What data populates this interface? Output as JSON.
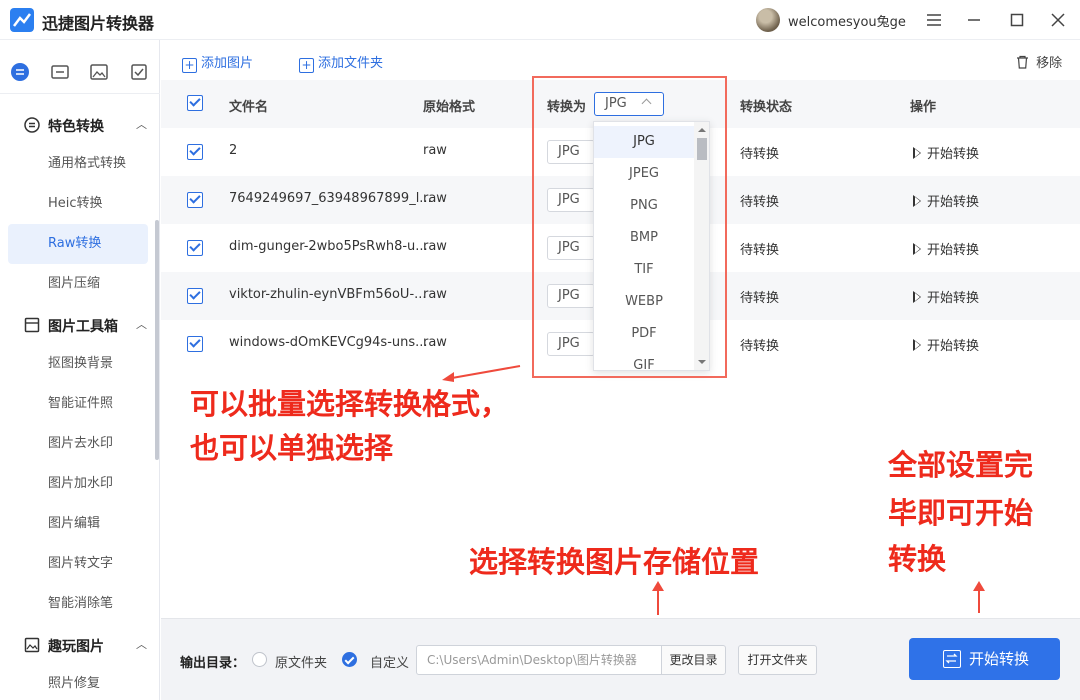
{
  "app": {
    "title": "迅捷图片转换器",
    "username": "welcomesyou兔ge",
    "window_controls": [
      "menu-icon",
      "minimize-icon",
      "maximize-icon",
      "close-icon"
    ]
  },
  "sidebar": {
    "top_icons": [
      "convert-icon",
      "toolbox-icon",
      "image-icon",
      "checklist-icon"
    ],
    "groups": [
      {
        "label": "特色转换",
        "icon": "convert-icon",
        "items": [
          "通用格式转换",
          "Heic转换",
          "Raw转换",
          "图片压缩"
        ],
        "active": "Raw转换"
      },
      {
        "label": "图片工具箱",
        "icon": "toolbox-icon",
        "items": [
          "抠图换背景",
          "智能证件照",
          "图片去水印",
          "图片加水印",
          "图片编辑",
          "图片转文字",
          "智能消除笔"
        ]
      },
      {
        "label": "趣玩图片",
        "icon": "image-icon",
        "items": [
          "照片修复"
        ]
      }
    ]
  },
  "toolbar": {
    "add_image": "添加图片",
    "add_folder": "添加文件夹",
    "remove": "移除"
  },
  "table": {
    "headers": {
      "filename": "文件名",
      "orig_format": "原始格式",
      "convert_to": "转换为",
      "status": "转换状态",
      "action": "操作"
    },
    "header_select_value": "JPG",
    "rows": [
      {
        "checked": true,
        "filename": "2",
        "orig_format": "raw",
        "target": "JPG",
        "status": "待转换",
        "action": "开始转换"
      },
      {
        "checked": true,
        "filename": "7649249697_63948967899_l...",
        "orig_format": "raw",
        "target": "JPG",
        "status": "待转换",
        "action": "开始转换"
      },
      {
        "checked": true,
        "filename": "dim-gunger-2wbo5PsRwh8-u...",
        "orig_format": "raw",
        "target": "JPG",
        "status": "待转换",
        "action": "开始转换"
      },
      {
        "checked": true,
        "filename": "viktor-zhulin-eynVBFm56oU-...",
        "orig_format": "raw",
        "target": "JPG",
        "status": "待转换",
        "action": "开始转换"
      },
      {
        "checked": true,
        "filename": "windows-dOmKEVCg94s-uns...",
        "orig_format": "raw",
        "target": "JPG",
        "status": "待转换",
        "action": "开始转换"
      }
    ]
  },
  "dropdown": {
    "options": [
      "JPG",
      "JPEG",
      "PNG",
      "BMP",
      "TIF",
      "WEBP",
      "PDF",
      "GIF"
    ],
    "selected": "JPG"
  },
  "annotations": {
    "batch_line1": "可以批量选择转换格式，",
    "batch_line2": "也可以单独选择",
    "storage": "选择转换图片存储位置",
    "done_line1": "全部设置完",
    "done_line2": "毕即可开始",
    "done_line3": "转换",
    "color": "#ee2a1c"
  },
  "output": {
    "label": "输出目录：",
    "option_original": "原文件夹",
    "option_custom": "自定义",
    "selected": "自定义",
    "path": "C:\\Users\\Admin\\Desktop\\图片转换器",
    "change_dir": "更改目录",
    "open_folder": "打开文件夹",
    "start_all": "开始转换"
  },
  "colors": {
    "accent": "#2e6fe0",
    "active_bg": "#eaf1fd",
    "annotation_red": "#ee2a1c"
  }
}
